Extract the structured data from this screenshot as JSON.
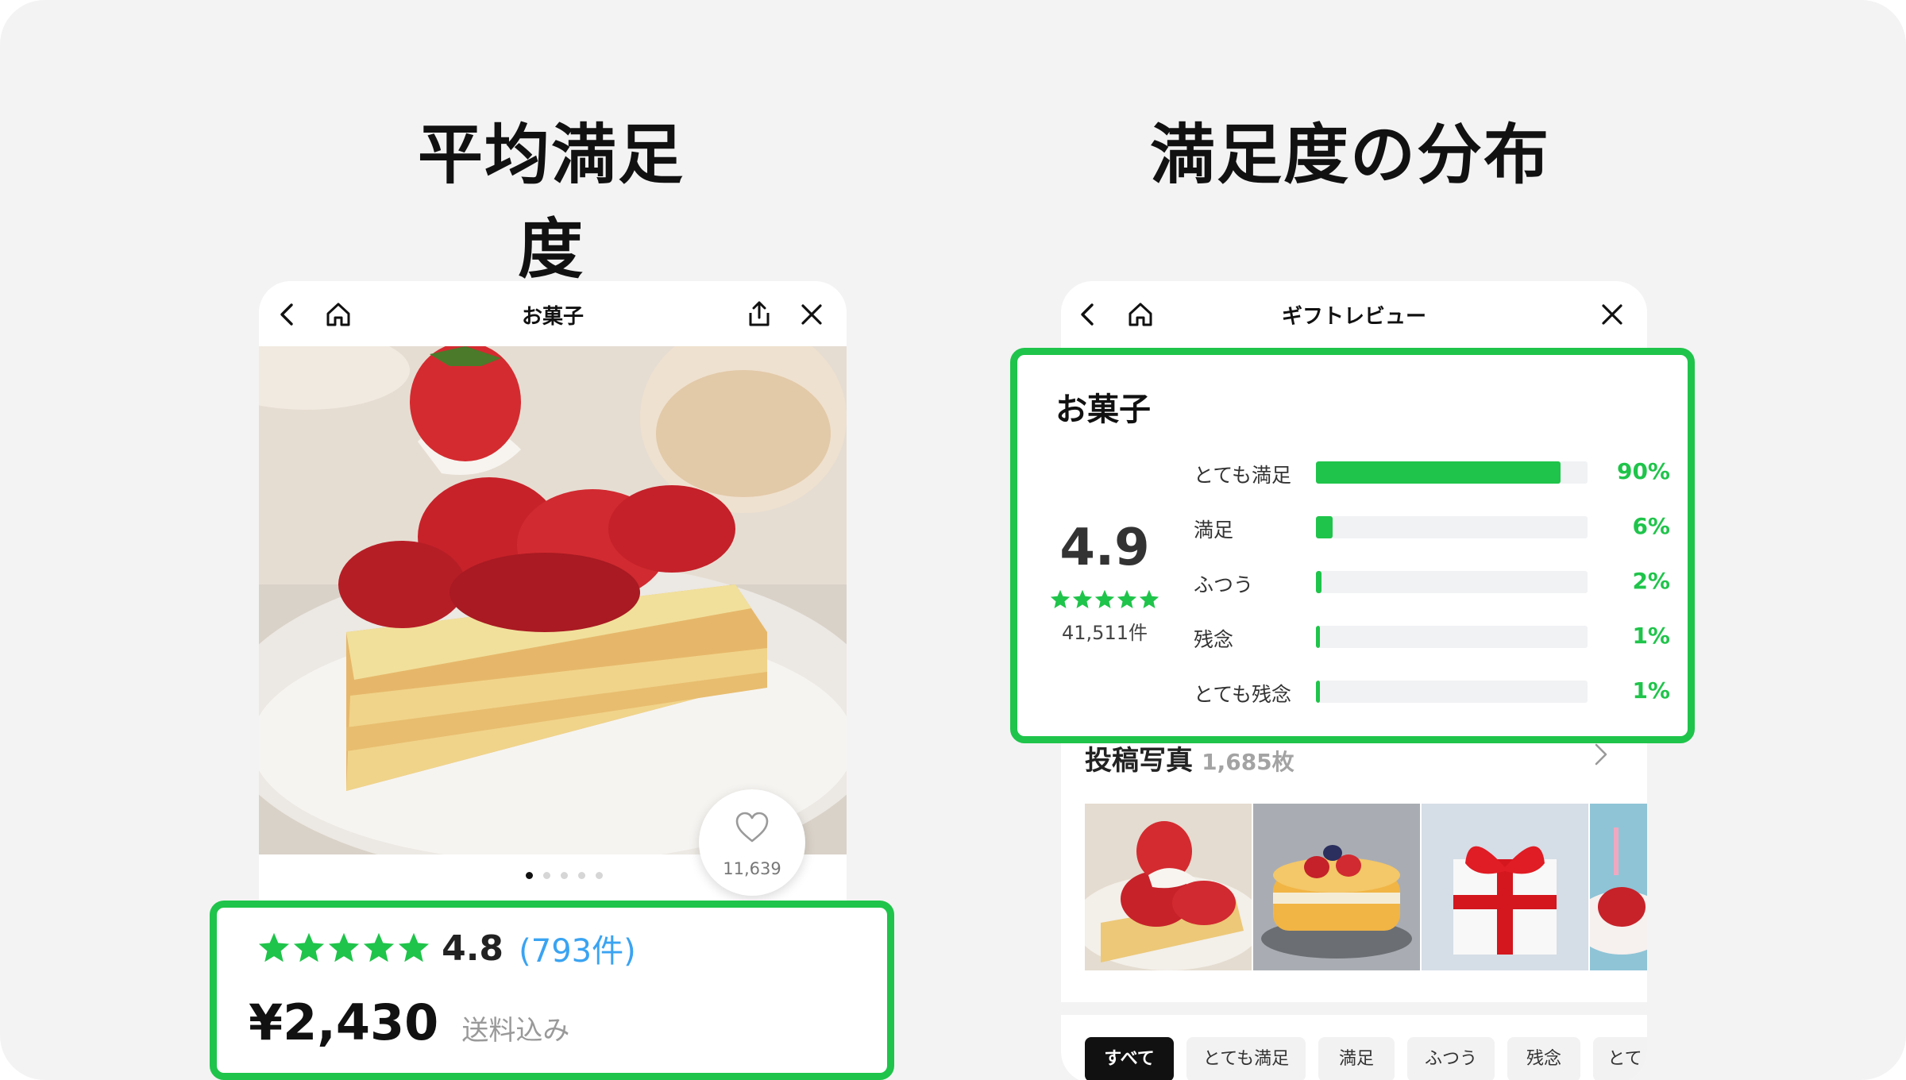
{
  "headings": {
    "left": "平均満足度",
    "right": "満足度の分布"
  },
  "product_screen": {
    "nav_title": "お菓子",
    "like_count": "11,639",
    "rating": "4.8",
    "rating_count": "(793件)",
    "star_rating": 5,
    "price": "¥2,430",
    "shipping_note": "送料込み",
    "pager": {
      "total": 5,
      "active_index": 0
    }
  },
  "review_screen": {
    "nav_title": "ギフトレビュー",
    "category": "お菓子",
    "average_score": "4.9",
    "star_rating": 5,
    "review_count": "41,511件",
    "distribution": [
      {
        "label": "とても満足",
        "percent_text": "90%",
        "fraction": 0.9
      },
      {
        "label": "満足",
        "percent_text": "6%",
        "fraction": 0.06
      },
      {
        "label": "ふつう",
        "percent_text": "2%",
        "fraction": 0.02
      },
      {
        "label": "残念",
        "percent_text": "1%",
        "fraction": 0.01
      },
      {
        "label": "とても残念",
        "percent_text": "1%",
        "fraction": 0.01
      }
    ],
    "photos_title": "投稿写真",
    "photos_count": "1,685枚",
    "filter_chips": [
      "すべて",
      "とても満足",
      "満足",
      "ふつう",
      "残念",
      "とて"
    ],
    "active_chip_index": 0
  },
  "colors": {
    "accent_green": "#1fc44a",
    "link_blue": "#3aa3f2",
    "background": "#f3f3f3"
  },
  "icons": [
    "back-icon",
    "home-icon",
    "share-icon",
    "close-icon",
    "heart-icon",
    "star-icon",
    "chevron-right-icon"
  ]
}
